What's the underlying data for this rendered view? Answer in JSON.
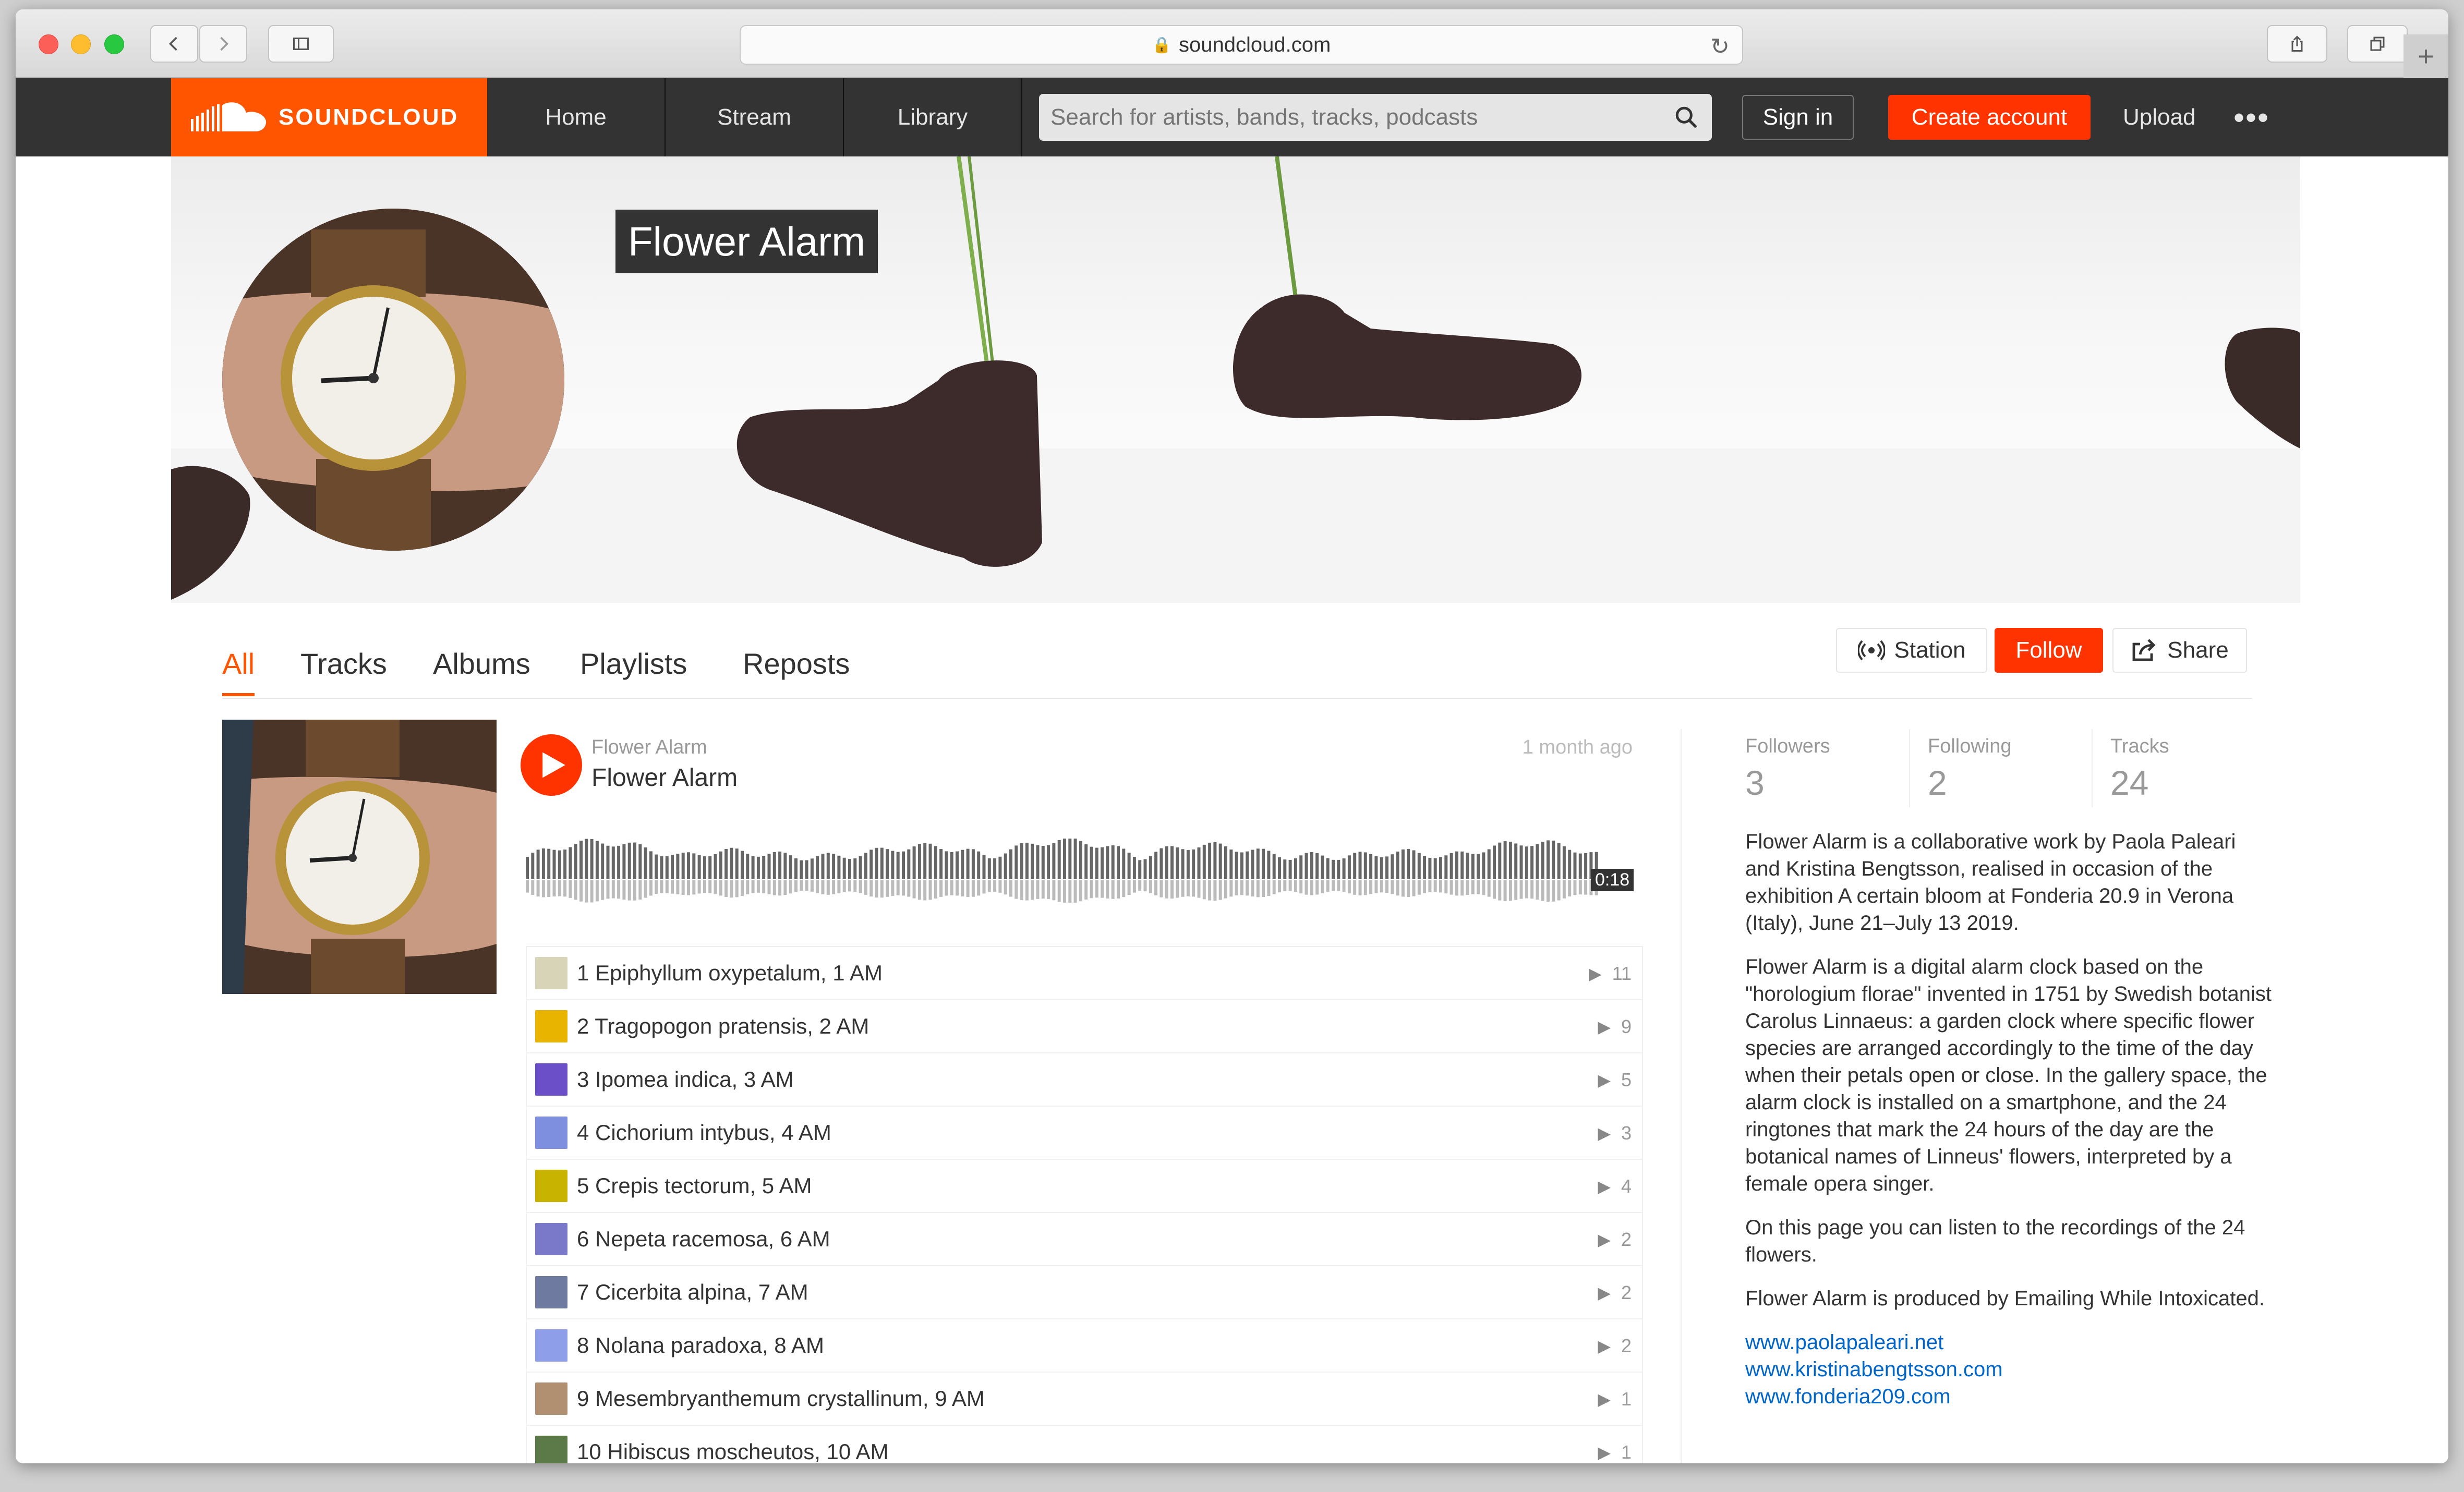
{
  "browser": {
    "url": "soundcloud.com"
  },
  "header": {
    "logo_text": "SOUNDCLOUD",
    "nav": [
      "Home",
      "Stream",
      "Library"
    ],
    "search_placeholder": "Search for artists, bands, tracks, podcasts",
    "sign_in": "Sign in",
    "create_account": "Create account",
    "upload": "Upload",
    "more": "•••",
    "accent_color": "#ff5500"
  },
  "profile": {
    "name": "Flower Alarm"
  },
  "tabs": [
    "All",
    "Tracks",
    "Albums",
    "Playlists",
    "Reposts"
  ],
  "actions": {
    "station": "Station",
    "follow": "Follow",
    "share": "Share"
  },
  "player": {
    "user": "Flower Alarm",
    "title": "Flower Alarm",
    "posted": "1 month ago",
    "duration": "0:18",
    "tracks": [
      {
        "label": "1 Epiphyllum oxypetalum, 1 AM",
        "plays": "11",
        "thumb_color": "#d8d4b8"
      },
      {
        "label": "2 Tragopogon pratensis, 2 AM",
        "plays": "9",
        "thumb_color": "#e8b400"
      },
      {
        "label": "3 Ipomea indica, 3 AM",
        "plays": "5",
        "thumb_color": "#6a4fc8"
      },
      {
        "label": "4 Cichorium intybus, 4 AM",
        "plays": "3",
        "thumb_color": "#7f8fe0"
      },
      {
        "label": "5 Crepis tectorum, 5 AM",
        "plays": "4",
        "thumb_color": "#c8b400"
      },
      {
        "label": "6 Nepeta racemosa, 6 AM",
        "plays": "2",
        "thumb_color": "#7a78c8"
      },
      {
        "label": "7 Cicerbita alpina, 7 AM",
        "plays": "2",
        "thumb_color": "#6e7aa0"
      },
      {
        "label": "8 Nolana paradoxa, 8 AM",
        "plays": "2",
        "thumb_color": "#8f9ee8"
      },
      {
        "label": "9 Mesembryanthemum crystallinum, 9 AM",
        "plays": "1",
        "thumb_color": "#b09070"
      },
      {
        "label": "10 Hibiscus moscheutos, 10 AM",
        "plays": "1",
        "thumb_color": "#5c7a48"
      }
    ]
  },
  "stats": {
    "followers_label": "Followers",
    "followers": "3",
    "following_label": "Following",
    "following": "2",
    "tracks_label": "Tracks",
    "tracks": "24"
  },
  "bio": {
    "p1": "Flower Alarm is a collaborative work by Paola Paleari and Kristina Bengtsson, realised in occasion of the exhibition A certain bloom at Fonderia 20.9 in Verona (Italy), June 21–July 13 2019.",
    "p2": "Flower Alarm is a digital alarm clock based on the \"horologium florae\" invented in 1751 by Swedish botanist Carolus Linnaeus: a garden clock where specific flower species are arranged accordingly to the time of the day when their petals open or close. In the gallery space, the alarm clock is installed on a smartphone, and the 24 ringtones that mark the 24 hours of the day are the botanical names of Linneus' flowers, interpreted by a female opera singer.",
    "p3": "On this page you can listen to the recordings of the 24 flowers.",
    "p4": "Flower Alarm is produced by Emailing While Intoxicated.",
    "links": [
      "www.paolapaleari.net",
      "www.kristinabengtsson.com",
      "www.fonderia209.com"
    ]
  }
}
